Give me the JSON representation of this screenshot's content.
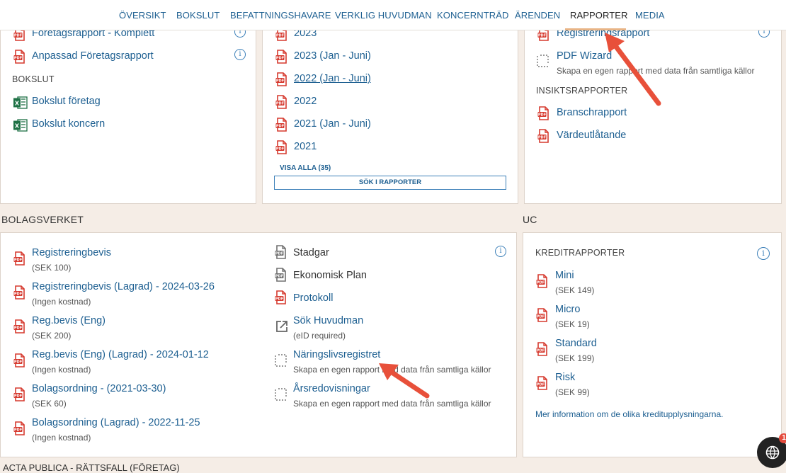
{
  "nav": {
    "items": [
      "ÖVERSIKT",
      "BOKSLUT",
      "BEFATTNINGSHAVARE",
      "VERKLIG HUVUDMAN",
      "KONCERNTRÄD",
      "ÄRENDEN",
      "RAPPORTER",
      "MEDIA"
    ],
    "active": "RAPPORTER"
  },
  "top_left": {
    "items": [
      "Företagsrapport - Komplett",
      "Anpassad Företagsrapport"
    ],
    "bokslut_heading": "BOKSLUT",
    "bokslut_items": [
      "Bokslut företag",
      "Bokslut koncern"
    ]
  },
  "top_middle": {
    "items": [
      "2023",
      "2023 (Jan - Juni)",
      "2022 (Jan - Juni)",
      "2022",
      "2021 (Jan - Juni)",
      "2021"
    ],
    "visa_alla": "VISA ALLA (35)",
    "search_button": "SÖK I RAPPORTER"
  },
  "top_right": {
    "item_top": "Registreringsrapport",
    "pdf_wizard": "PDF Wizard",
    "pdf_wizard_sub": "Skapa en egen rapport med data från samtliga källor",
    "insikts_heading": "INSIKTSRAPPORTER",
    "insikts_items": [
      "Branschrapport",
      "Värdeutlåtande"
    ]
  },
  "bolagsverket": {
    "heading": "BOLAGSVERKET",
    "left_items": [
      {
        "title": "Registreringbevis",
        "sub": "(SEK 100)"
      },
      {
        "title": "Registreringbevis (Lagrad) - 2024-03-26",
        "sub": "(Ingen kostnad)"
      },
      {
        "title": "Reg.bevis (Eng)",
        "sub": "(SEK 200)"
      },
      {
        "title": "Reg.bevis (Eng) (Lagrad) - 2024-01-12",
        "sub": "(Ingen kostnad)"
      },
      {
        "title": "Bolagsordning - (2021-03-30)",
        "sub": "(SEK 60)"
      },
      {
        "title": "Bolagsordning (Lagrad) - 2022-11-25",
        "sub": "(Ingen kostnad)"
      }
    ],
    "right_items": [
      {
        "title": "Stadgar",
        "sub": ""
      },
      {
        "title": "Ekonomisk Plan",
        "sub": ""
      },
      {
        "title": "Protokoll",
        "sub": ""
      },
      {
        "title": "Sök Huvudman",
        "sub": "(eID required)"
      },
      {
        "title": "Näringslivsregistret",
        "sub": "Skapa en egen rapport med data från samtliga källor"
      },
      {
        "title": "Årsredovisningar",
        "sub": "Skapa en egen rapport med data från samtliga källor"
      }
    ]
  },
  "uc": {
    "heading": "UC",
    "kredit_heading": "KREDITRAPPORTER",
    "items": [
      {
        "title": "Mini",
        "sub": "(SEK 149)"
      },
      {
        "title": "Micro",
        "sub": "(SEK 19)"
      },
      {
        "title": "Standard",
        "sub": "(SEK 199)"
      },
      {
        "title": "Risk",
        "sub": "(SEK 99)"
      }
    ],
    "more_info": "Mer information om de olika kreditupplysningarna."
  },
  "bottom_heading": "ACTA PUBLICA - RÄTTSFALL (FÖRETAG)",
  "chat_badge": "1",
  "colors": {
    "link": "#1d5f91",
    "pdf_red": "#d63a2f",
    "excel_green": "#1e7145",
    "background": "#f5ede6",
    "arrow": "#e8503a"
  }
}
